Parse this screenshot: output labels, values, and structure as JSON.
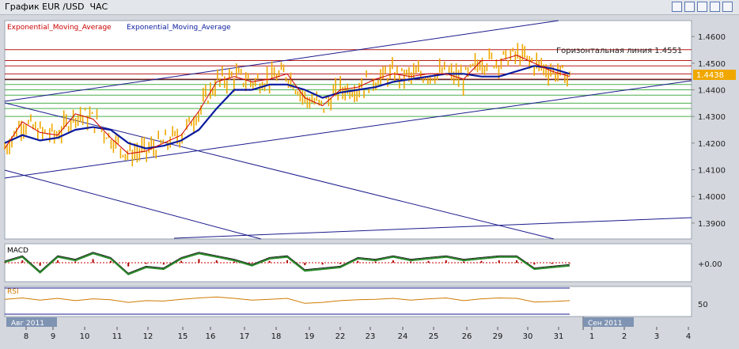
{
  "window": {
    "title": "График EUR /USD  ЧАС",
    "buttons": [
      "help-icon",
      "restore-icon",
      "minimize-icon",
      "maximize-icon",
      "close-icon"
    ]
  },
  "indicators": {
    "ema_label_1": "Exponential_Moving_Average",
    "ema_label_2": "Exponential_Moving_Average",
    "ema1_color": "#cc0000",
    "ema2_color": "#0a1a9e",
    "price_color": "#f0a800"
  },
  "annotations": {
    "horizontal_line_label": "Горизонтальная линия 1.4551",
    "current_price": "1.4438"
  },
  "chart_data": [
    {
      "type": "line",
      "title": "EUR /USD",
      "ylim": [
        1.384,
        1.466
      ],
      "y_ticks": [
        "1.4600",
        "1.4500",
        "1.4400",
        "1.4300",
        "1.4200",
        "1.4100",
        "1.4000",
        "1.3900"
      ],
      "current_price": 1.4438,
      "horizontal_lines_red": [
        1.4551,
        1.451,
        1.449,
        1.446,
        1.444
      ],
      "horizontal_lines_green": [
        1.442,
        1.44,
        1.438,
        1.435,
        1.433,
        1.43
      ],
      "x_labels": [
        "8",
        "9",
        "10",
        "11",
        "12",
        "15",
        "16",
        "17",
        "18",
        "19",
        "22",
        "23",
        "24",
        "25",
        "26",
        "29",
        "30",
        "31",
        "1",
        "2",
        "3",
        "4"
      ],
      "month_labels": [
        "Авг 2011",
        "Сен 2011"
      ],
      "series": [
        {
          "name": "Exponential_Moving_Average",
          "color": "#0a1a9e",
          "values": [
            1.42,
            1.423,
            1.421,
            1.422,
            1.425,
            1.426,
            1.425,
            1.42,
            1.418,
            1.419,
            1.421,
            1.425,
            1.433,
            1.44,
            1.44,
            1.442,
            1.442,
            1.44,
            1.437,
            1.439,
            1.44,
            1.441,
            1.443,
            1.444,
            1.445,
            1.446,
            1.446,
            1.445,
            1.445,
            1.447,
            1.449,
            1.448,
            1.446
          ]
        },
        {
          "name": "Exponential_Moving_Average",
          "color": "#cc0000",
          "values": [
            1.418,
            1.428,
            1.424,
            1.423,
            1.431,
            1.429,
            1.422,
            1.416,
            1.417,
            1.42,
            1.423,
            1.432,
            1.443,
            1.445,
            1.443,
            1.444,
            1.446,
            1.437,
            1.434,
            1.44,
            1.441,
            1.444,
            1.446,
            1.445,
            1.446,
            1.446,
            1.444,
            1.451,
            1.451,
            1.453,
            1.45,
            1.447,
            1.445
          ]
        }
      ]
    },
    {
      "type": "line",
      "title": "MACD",
      "ylim": [
        -0.01,
        0.01
      ],
      "y_ticks": [
        "+0.00"
      ],
      "series": [
        {
          "name": "MACD",
          "color": "#2a8a2a",
          "values": [
            0.001,
            0.004,
            -0.005,
            0.004,
            0.002,
            0.006,
            0.003,
            -0.006,
            -0.002,
            -0.003,
            0.003,
            0.006,
            0.004,
            0.002,
            -0.001,
            0.003,
            0.004,
            -0.004,
            -0.003,
            -0.002,
            0.003,
            0.002,
            0.004,
            0.002,
            0.003,
            0.004,
            0.002,
            0.003,
            0.004,
            0.004,
            -0.003,
            -0.002,
            -0.001
          ]
        }
      ]
    },
    {
      "type": "line",
      "title": "RSI",
      "ylim": [
        20,
        80
      ],
      "y_ticks": [
        "50"
      ],
      "series": [
        {
          "name": "RSI",
          "color": "#d07a00",
          "values": [
            55,
            58,
            53,
            57,
            52,
            56,
            54,
            48,
            52,
            51,
            55,
            58,
            60,
            57,
            53,
            55,
            57,
            46,
            48,
            52,
            54,
            55,
            57,
            53,
            56,
            58,
            52,
            56,
            58,
            57,
            49,
            50,
            52
          ]
        }
      ]
    }
  ]
}
